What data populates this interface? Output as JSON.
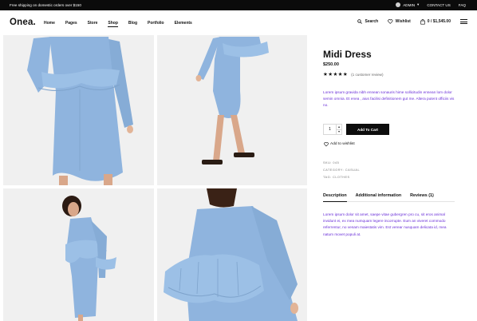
{
  "topbar": {
    "promo": "Free shipping on domestic orders over $150",
    "admin_label": "ADMIN",
    "contact_label": "CONTACT US",
    "faq_label": "FAQ"
  },
  "header": {
    "logo": "Onea.",
    "nav": [
      "Home",
      "Pages",
      "Store",
      "Shop",
      "Blog",
      "Portfolio",
      "Elements"
    ],
    "active_nav": "Shop",
    "search_label": "Search",
    "wishlist_label": "Wishlist",
    "cart_label": "0 / $1,545.00"
  },
  "product": {
    "title": "Midi Dress",
    "price": "$250.00",
    "rating_stars": 5,
    "stars_text": "★★★★★",
    "review_text": "(1 customer review)",
    "description": "Lorem ipsum gravida nibh ennean sonauris hime sollicitudin ennean lom dolor semin omnia. Et enea , aius facilisi definitionem gut me. Altera putent officiis vis no.",
    "quantity": "1",
    "add_to_cart": "Add To Cart",
    "add_to_wishlist": "Add to wishlist",
    "sku": "SKU: 045",
    "category": "CATEGORY: CASUAL",
    "tag": "TAG: CLOTHES"
  },
  "tabs": {
    "items": [
      "Description",
      "Additional information",
      "Reviews (1)"
    ],
    "active": "Description",
    "body": "Lorem ipsum dolor sit amet, saepe vitae gubergren pro cu, sit eros animal invidunt ei, ex mea numquam legere incorrupte. Eum an viveret commodo referrentur, no venam maiestatis vim. Est verear nusquam delicata id, mea natum movet populi at."
  },
  "colors": {
    "topbar_bg": "#0b0b0b",
    "dress_blue": "#8fb4de",
    "link_purple": "#6a2fd8",
    "button_bg": "#0d0d0d"
  },
  "icons": [
    "user-icon",
    "chevron-down-icon",
    "search-icon",
    "heart-icon",
    "bag-icon",
    "hamburger-icon",
    "star-icon",
    "up-arrow-icon",
    "down-arrow-icon"
  ]
}
